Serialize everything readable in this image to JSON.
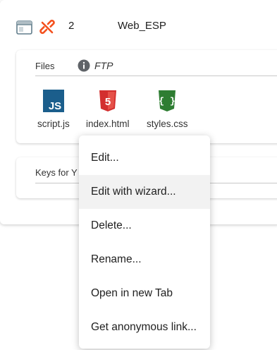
{
  "row": {
    "icons": [
      "window-icon",
      "unlink-icon"
    ],
    "number": "2",
    "name": "Web_ESP"
  },
  "files_section": {
    "label": "Files",
    "info_icon": "info-icon",
    "protocol": "FTP",
    "files": [
      {
        "name": "script.js",
        "icon": "js-file-icon",
        "icon_text": "JS",
        "color": "#1b5e8c"
      },
      {
        "name": "index.html",
        "icon": "html5-icon",
        "icon_text": "5",
        "color": "#d32f2f"
      },
      {
        "name": "styles.css",
        "icon": "css-braces-icon",
        "icon_text": "{ }",
        "color": "#2e7d32"
      }
    ]
  },
  "keys_section": {
    "label": "Keys for Y"
  },
  "context_menu": {
    "items": [
      "Edit...",
      "Edit with wizard...",
      "Delete...",
      "Rename...",
      "Open in new Tab",
      "Get anonymous link..."
    ],
    "highlighted_index": 1
  },
  "colors": {
    "unlink_icon": "#f4511e",
    "window_icon": "#607d8b",
    "info_icon": "#5f6368",
    "menu_hover": "#f2f2f2"
  }
}
